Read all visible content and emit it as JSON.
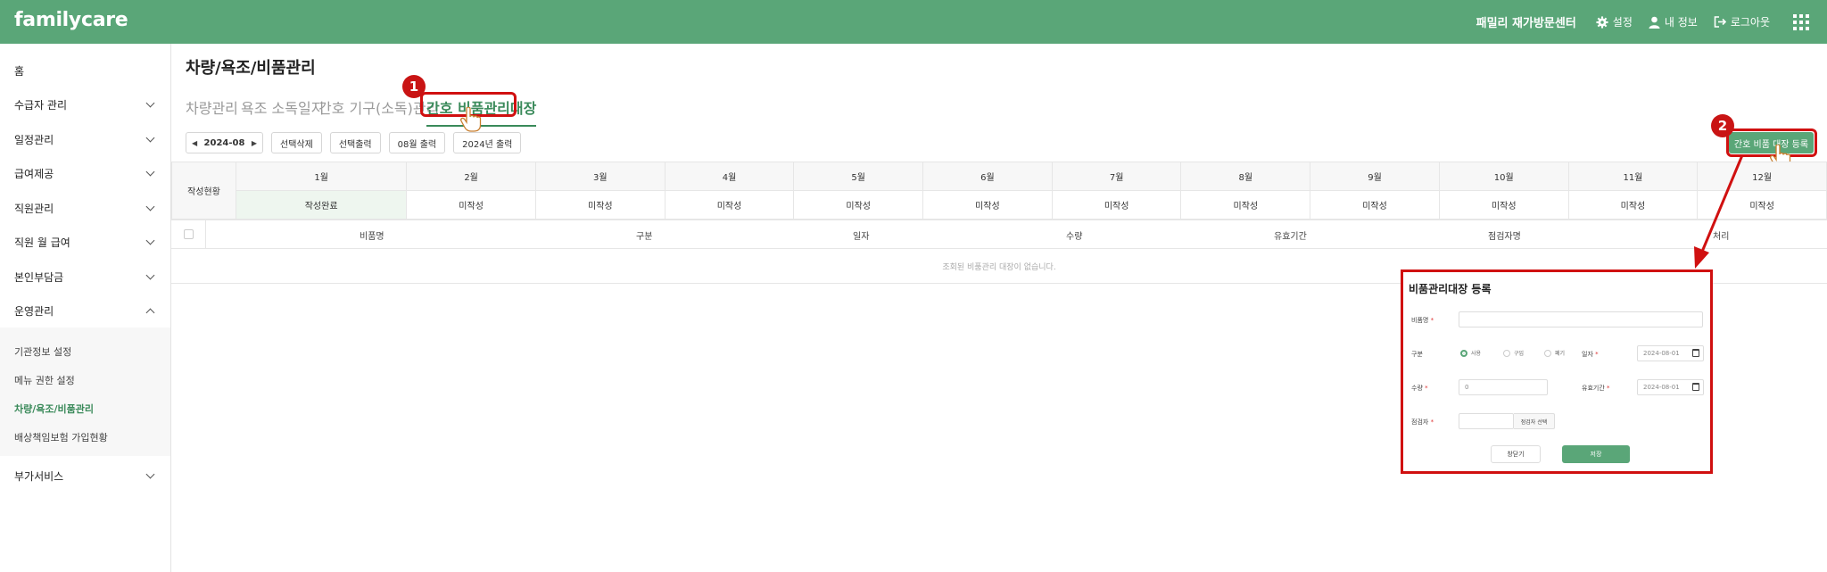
{
  "header": {
    "logo": "familycare",
    "center_name": "패밀리 재가방문센터",
    "settings_label": "설정",
    "myinfo_label": "내 정보",
    "logout_label": "로그아웃"
  },
  "sidebar": {
    "items": [
      {
        "label": "홈"
      },
      {
        "label": "수급자 관리"
      },
      {
        "label": "일정관리"
      },
      {
        "label": "급여제공"
      },
      {
        "label": "직원관리"
      },
      {
        "label": "직원 월 급여"
      },
      {
        "label": "본인부담금"
      },
      {
        "label": "운영관리"
      },
      {
        "label": "부가서비스"
      }
    ],
    "sub_items": [
      {
        "label": "기관정보 설정"
      },
      {
        "label": "메뉴 권한 설정"
      },
      {
        "label": "차량/욕조/비품관리"
      },
      {
        "label": "배상책임보험 가입현황"
      }
    ]
  },
  "main": {
    "title": "차량/욕조/비품관리",
    "tabs": [
      {
        "label": "차량관리"
      },
      {
        "label": "욕조 소독일지"
      },
      {
        "label": "간호 기구(소독)관리"
      },
      {
        "label": "간호 비품관리대장"
      }
    ],
    "toolbar": {
      "month": "2024-08",
      "delete_selected": "선택삭제",
      "print_selected": "선택출력",
      "print_month": "08월 출력",
      "print_year": "2024년 출력",
      "register": "간호 비품 대장 등록"
    },
    "status_table": {
      "row_header": "작성현황",
      "months": [
        "1월",
        "2월",
        "3월",
        "4월",
        "5월",
        "6월",
        "7월",
        "8월",
        "9월",
        "10월",
        "11월",
        "12월"
      ],
      "statuses": [
        "작성완료",
        "미작성",
        "미작성",
        "미작성",
        "미작성",
        "미작성",
        "미작성",
        "미작성",
        "미작성",
        "미작성",
        "미작성",
        "미작성"
      ]
    },
    "list_table": {
      "columns": [
        "비품명",
        "구분",
        "일자",
        "수량",
        "유효기간",
        "점검자명",
        "처리"
      ],
      "empty_message": "조회된 비품관리 대장이 없습니다."
    }
  },
  "annotations": {
    "badge1": "1",
    "badge2": "2"
  },
  "modal": {
    "title": "비품관리대장 등록",
    "item_name_label": "비품명",
    "type_label": "구분",
    "type_options": [
      "사용",
      "구입",
      "폐기"
    ],
    "date_label": "일자",
    "date_value": "2024-08-01",
    "qty_label": "수량",
    "qty_value": "0",
    "expiry_label": "유효기간",
    "expiry_value": "2024-08-01",
    "inspector_label": "점검자",
    "inspector_button": "점검자 선택",
    "close_button": "창닫기",
    "save_button": "저장",
    "required_mark": "*"
  },
  "colors": {
    "brand": "#5aa678",
    "annotation": "#d01010"
  }
}
